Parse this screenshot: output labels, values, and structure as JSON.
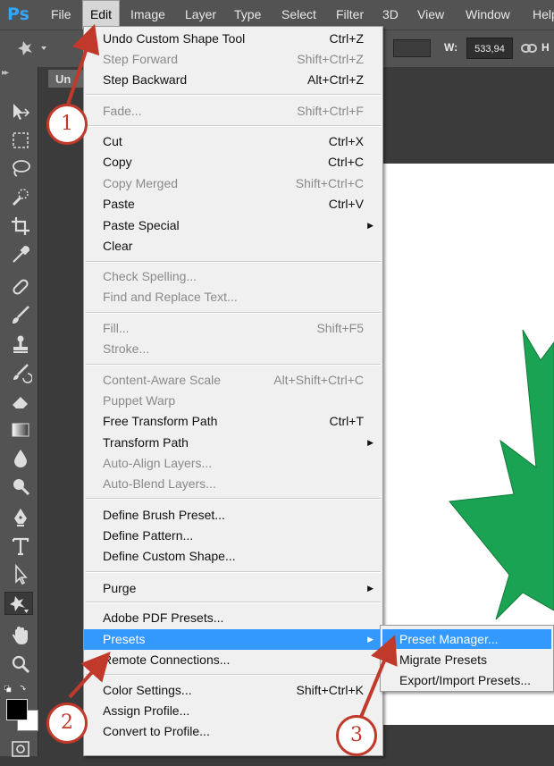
{
  "app": {
    "logo": "Ps"
  },
  "menubar": [
    "File",
    "Edit",
    "Image",
    "Layer",
    "Type",
    "Select",
    "Filter",
    "3D",
    "View",
    "Window",
    "Help"
  ],
  "options": {
    "w_label": "W:",
    "w_value": "533,94",
    "h_label": "H"
  },
  "document_tab": "Un",
  "edit_menu": [
    {
      "label": "Undo Custom Shape Tool",
      "shortcut": "Ctrl+Z"
    },
    {
      "label": "Step Forward",
      "shortcut": "Shift+Ctrl+Z"
    },
    {
      "label": "Step Backward",
      "shortcut": "Alt+Ctrl+Z"
    },
    {
      "label": "Fade...",
      "shortcut": "Shift+Ctrl+F"
    },
    {
      "label": "Cut",
      "shortcut": "Ctrl+X"
    },
    {
      "label": "Copy",
      "shortcut": "Ctrl+C"
    },
    {
      "label": "Copy Merged",
      "shortcut": "Shift+Ctrl+C"
    },
    {
      "label": "Paste",
      "shortcut": "Ctrl+V"
    },
    {
      "label": "Paste Special",
      "shortcut": "▶"
    },
    {
      "label": "Clear",
      "shortcut": ""
    },
    {
      "label": "Check Spelling...",
      "shortcut": ""
    },
    {
      "label": "Find and Replace Text...",
      "shortcut": ""
    },
    {
      "label": "Fill...",
      "shortcut": "Shift+F5"
    },
    {
      "label": "Stroke...",
      "shortcut": ""
    },
    {
      "label": "Content-Aware Scale",
      "shortcut": "Alt+Shift+Ctrl+C"
    },
    {
      "label": "Puppet Warp",
      "shortcut": ""
    },
    {
      "label": "Free Transform Path",
      "shortcut": "Ctrl+T"
    },
    {
      "label": "Transform Path",
      "shortcut": "▶"
    },
    {
      "label": "Auto-Align Layers...",
      "shortcut": ""
    },
    {
      "label": "Auto-Blend Layers...",
      "shortcut": ""
    },
    {
      "label": "Define Brush Preset...",
      "shortcut": ""
    },
    {
      "label": "Define Pattern...",
      "shortcut": ""
    },
    {
      "label": "Define Custom Shape...",
      "shortcut": ""
    },
    {
      "label": "Purge",
      "shortcut": "▶"
    },
    {
      "label": "Adobe PDF Presets...",
      "shortcut": ""
    },
    {
      "label": "Presets",
      "shortcut": "▶"
    },
    {
      "label": "Remote Connections...",
      "shortcut": ""
    },
    {
      "label": "Color Settings...",
      "shortcut": "Shift+Ctrl+K"
    },
    {
      "label": "Assign Profile...",
      "shortcut": ""
    },
    {
      "label": "Convert to Profile...",
      "shortcut": ""
    }
  ],
  "presets_submenu": [
    "Preset Manager...",
    "Migrate Presets",
    "Export/Import Presets..."
  ],
  "callouts": [
    "1",
    "2",
    "3"
  ],
  "colors": {
    "highlight": "#3399ff",
    "callout": "#c0392b",
    "star": "#1aa352"
  }
}
